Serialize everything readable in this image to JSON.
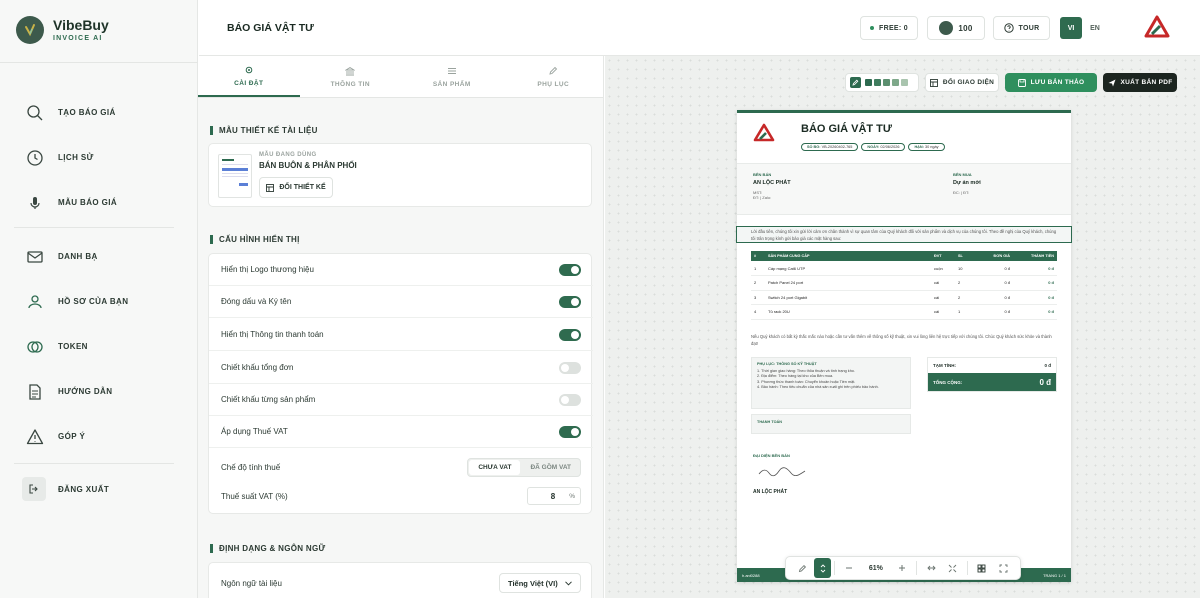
{
  "brand": {
    "name": "VibeBuy",
    "sub": "INVOICE AI"
  },
  "sidebar": {
    "items": [
      {
        "label": "TẠO BÁO GIÁ",
        "icon": "search-icon"
      },
      {
        "label": "LỊCH SỬ",
        "icon": "clock-icon"
      },
      {
        "label": "MẪU BÁO GIÁ",
        "icon": "microphone-icon"
      },
      {
        "label": "DANH BẠ",
        "icon": "contacts-icon"
      },
      {
        "label": "HỒ SƠ CỦA BẠN",
        "icon": "user-icon"
      },
      {
        "label": "TOKEN",
        "icon": "coins-icon"
      },
      {
        "label": "HƯỚNG DẪN",
        "icon": "document-icon"
      },
      {
        "label": "GÓP Ý",
        "icon": "warning-icon"
      }
    ],
    "logout": "ĐĂNG XUẤT"
  },
  "topbar": {
    "title": "BÁO GIÁ VẬT TƯ",
    "free": "FREE: 0",
    "tokens": "100",
    "tour": "TOUR",
    "lang_vi": "VI",
    "lang_en": "EN"
  },
  "tabs": [
    {
      "label": "CÀI ĐẶT",
      "icon": "gear-icon"
    },
    {
      "label": "THÔNG TIN",
      "icon": "bank-icon"
    },
    {
      "label": "SẢN PHẨM",
      "icon": "list-icon"
    },
    {
      "label": "PHỤ LỤC",
      "icon": "pen-icon"
    }
  ],
  "template": {
    "section": "MẪU THIẾT KẾ TÀI LIỆU",
    "caption": "MẪU ĐANG DÙNG",
    "name": "BÁN BUÔN & PHÂN PHỐI",
    "change": "ĐỔI THIẾT KẾ"
  },
  "display": {
    "section": "CẤU HÌNH HIỂN THỊ",
    "rows": [
      {
        "label": "Hiển thị Logo thương hiệu",
        "on": true
      },
      {
        "label": "Đóng dấu và Ký tên",
        "on": true
      },
      {
        "label": "Hiển thị Thông tin thanh toán",
        "on": true
      },
      {
        "label": "Chiết khấu tổng đơn",
        "on": false
      },
      {
        "label": "Chiết khấu từng sản phẩm",
        "on": false
      },
      {
        "label": "Áp dụng Thuế VAT",
        "on": true
      }
    ],
    "tax_mode_label": "Chế độ tính thuế",
    "tax_mode_options": [
      "CHƯA VAT",
      "ĐÃ GỒM VAT"
    ],
    "vat_label": "Thuế suất VAT (%)",
    "vat_value": "8",
    "vat_unit": "%"
  },
  "format": {
    "section": "ĐỊNH DẠNG & NGÔN NGỮ",
    "lang_label": "Ngôn ngữ tài liệu",
    "lang_value": "Tiếng Việt (VI)"
  },
  "preview": {
    "change_ui": "ĐỔI GIAO DIỆN",
    "save": "LƯU BẢN THẢO",
    "export": "XUẤT BẢN PDF",
    "swatches": [
      "#2d6a4f",
      "#3f7d5e",
      "#5b8f6f",
      "#7ea88a",
      "#a9c4ae"
    ],
    "zoom": "61%"
  },
  "doc": {
    "title": "BÁO GIÁ VẬT TƯ",
    "pills": [
      {
        "k": "SỐ BG:",
        "v": "VB-20260402-765"
      },
      {
        "k": "NGÀY:",
        "v": "02/06/2026"
      },
      {
        "k": "HẠN:",
        "v": "30 ngày"
      }
    ],
    "seller_cap": "BÊN BÁN",
    "seller": "AN LỘC PHÁT",
    "seller_lines": [
      "MST:",
      "ĐT: | Zalo:"
    ],
    "buyer_cap": "BÊN MUA",
    "buyer": "Dự án mới",
    "buyer_lines": [
      "ĐC: | ĐT:"
    ],
    "intro": "Lời đầu tiên, chúng tôi xin gửi lời cảm ơn chân thành vì sự quan tâm của Quý khách đối với sản phẩm và dịch vụ của chúng tôi. Theo đề nghị của Quý khách, chúng tôi trân trọng kính gửi bảo giá các mặt hàng sau:",
    "table": {
      "headers": [
        "#",
        "SẢN PHẨM CUNG CẤP",
        "ĐVT",
        "SL",
        "ĐƠN GIÁ",
        "THÀNH TIỀN"
      ],
      "rows": [
        [
          "1",
          "Cáp mạng Cat6 UTP",
          "cuộn",
          "10",
          "0 đ",
          "0 đ"
        ],
        [
          "2",
          "Patch Panel 24 port",
          "cái",
          "2",
          "0 đ",
          "0 đ"
        ],
        [
          "3",
          "Switch 24 port Gigabit",
          "cái",
          "2",
          "0 đ",
          "0 đ"
        ],
        [
          "4",
          "Tủ rack 20U",
          "cái",
          "1",
          "0 đ",
          "0 đ"
        ]
      ]
    },
    "note": "Nếu Quý khách có bất kỳ thắc mắc nào hoặc cần tư vấn thêm về thông số kỹ thuật, xin vui lòng liên hệ trực tiếp với chúng tôi. Chúc Quý khách sức khỏe và thành đạt!",
    "terms_cap": "PHỤ LỤC: THÔNG SỐ KỸ THUẬT",
    "terms": [
      "1. Thời gian giao hàng: Theo thỏa thuận và tình trạng kho.",
      "2. Địa điểm: Theo hàng tại kho của Bên mua.",
      "3. Phương thức thanh toán: Chuyển khoản hoặc Tiền mặt.",
      "4. Bảo hành: Theo tiêu chuẩn của nhà sản xuất ghi trên phiếu bảo hành."
    ],
    "pay_cap": "THANH TOÁN",
    "subtotal_label": "TẠM TÍNH:",
    "subtotal": "0 đ",
    "total_label": "TỔNG CỘNG:",
    "total": "0 đ",
    "sign_cap": "ĐẠI DIỆN BÊN BÁN",
    "sign_name": "AN LỘC PHÁT",
    "footer_left": "h.anl0288",
    "footer_right": "TRANG 1 / 1"
  }
}
